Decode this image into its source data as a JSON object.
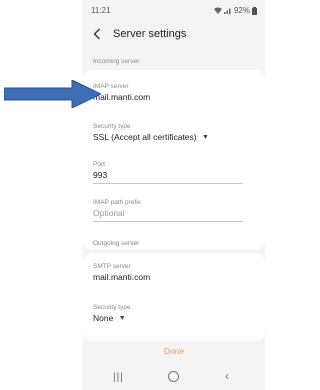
{
  "status_bar": {
    "time": "11:21",
    "battery": "92%"
  },
  "header": {
    "back_icon": "chevron-left-icon",
    "title": "Server settings"
  },
  "incoming": {
    "section_label": "Incoming server",
    "imap_server": {
      "label": "IMAP server",
      "value": "mail.manti.com"
    },
    "security_type": {
      "label": "Security type",
      "value": "SSL (Accept all certificates)"
    },
    "port": {
      "label": "Port",
      "value": "993"
    },
    "imap_path_prefix": {
      "label": "IMAP path prefix",
      "placeholder": "Optional"
    }
  },
  "outgoing": {
    "section_label": "Outgoing server",
    "smtp_server": {
      "label": "SMTP server",
      "value": "mail.manti.com"
    },
    "security_type": {
      "label": "Security type",
      "value": "None"
    }
  },
  "footer": {
    "done_label": "Done"
  },
  "colors": {
    "arrow": "#3d6db5",
    "done": "#e8a06c",
    "screen_background": "#f4f4f4"
  }
}
